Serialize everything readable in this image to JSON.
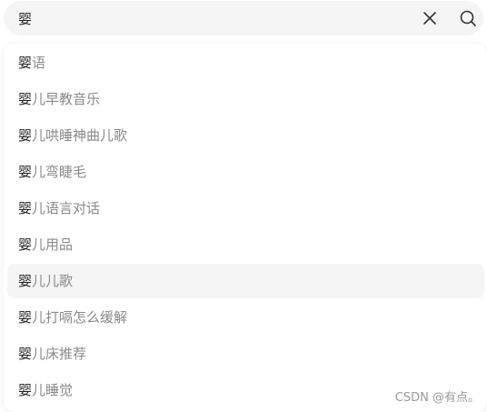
{
  "search": {
    "value": "婴",
    "placeholder": ""
  },
  "icons": {
    "clear": "close-icon",
    "search": "search-icon"
  },
  "suggestions": [
    {
      "prefix": "婴",
      "rest": "语"
    },
    {
      "prefix": "婴",
      "rest": "儿早教音乐"
    },
    {
      "prefix": "婴",
      "rest": "儿哄睡神曲儿歌"
    },
    {
      "prefix": "婴",
      "rest": "儿弯睫毛"
    },
    {
      "prefix": "婴",
      "rest": "儿语言对话"
    },
    {
      "prefix": "婴",
      "rest": "儿用品"
    },
    {
      "prefix": "婴",
      "rest": "儿儿歌"
    },
    {
      "prefix": "婴",
      "rest": "儿打嗝怎么缓解"
    },
    {
      "prefix": "婴",
      "rest": "儿床推荐"
    },
    {
      "prefix": "婴",
      "rest": "儿睡觉"
    }
  ],
  "highlighted_index": 6,
  "watermark": "CSDN @有点。",
  "colors": {
    "search_bg": "#f5f5f5",
    "highlight_bg": "#f5f5f5",
    "text_primary": "#222222",
    "text_secondary": "#8a8a8a",
    "watermark": "#9a9a9a"
  }
}
